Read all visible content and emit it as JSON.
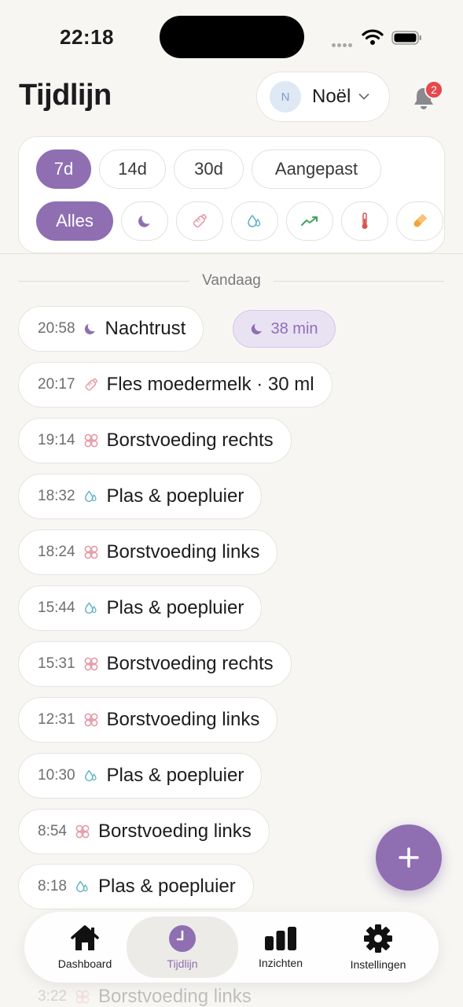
{
  "status_bar": {
    "time": "22:18"
  },
  "header": {
    "title": "Tijdlijn",
    "child": {
      "initial": "N",
      "name": "Noël"
    },
    "notifications_count": "2"
  },
  "filters": {
    "ranges": [
      "7d",
      "14d",
      "30d",
      "Aangepast"
    ],
    "active_range": "7d",
    "all_label": "Alles",
    "categories": [
      "moon-icon",
      "bottle-icon",
      "drop-icon",
      "trend-up-icon",
      "thermometer-icon",
      "pill-icon"
    ]
  },
  "timeline": {
    "section_label": "Vandaag",
    "entries": [
      {
        "time": "20:58",
        "icon": "moon-icon",
        "label": "Nachtrust"
      },
      {
        "time": "20:17",
        "icon": "bottle-icon",
        "label": "Fles moedermelk · 30 ml"
      },
      {
        "time": "19:14",
        "icon": "breastfeeding-icon",
        "label": "Borstvoeding rechts"
      },
      {
        "time": "18:32",
        "icon": "drop-icon",
        "label": "Plas & poepluier"
      },
      {
        "time": "18:24",
        "icon": "breastfeeding-icon",
        "label": "Borstvoeding links"
      },
      {
        "time": "15:44",
        "icon": "drop-icon",
        "label": "Plas & poepluier"
      },
      {
        "time": "15:31",
        "icon": "breastfeeding-icon",
        "label": "Borstvoeding rechts"
      },
      {
        "time": "12:31",
        "icon": "breastfeeding-icon",
        "label": "Borstvoeding links"
      },
      {
        "time": "10:30",
        "icon": "drop-icon",
        "label": "Plas & poepluier"
      },
      {
        "time": "8:54",
        "icon": "breastfeeding-icon",
        "label": "Borstvoeding links"
      },
      {
        "time": "8:18",
        "icon": "drop-icon",
        "label": "Plas & poepluier"
      },
      {
        "time": "3:22",
        "icon": "breastfeeding-icon",
        "label": "Borstvoeding links"
      }
    ],
    "sleep_duration": "38 min"
  },
  "nav": {
    "items": [
      {
        "label": "Dashboard",
        "icon": "home-icon"
      },
      {
        "label": "Tijdlijn",
        "icon": "clock-icon"
      },
      {
        "label": "Inzichten",
        "icon": "bar-chart-icon"
      },
      {
        "label": "Instellingen",
        "icon": "gear-icon"
      }
    ],
    "active": "Tijdlijn"
  },
  "colors": {
    "accent": "#8f6fb2",
    "badge": "#e5484d",
    "background": "#f7f6f3"
  }
}
